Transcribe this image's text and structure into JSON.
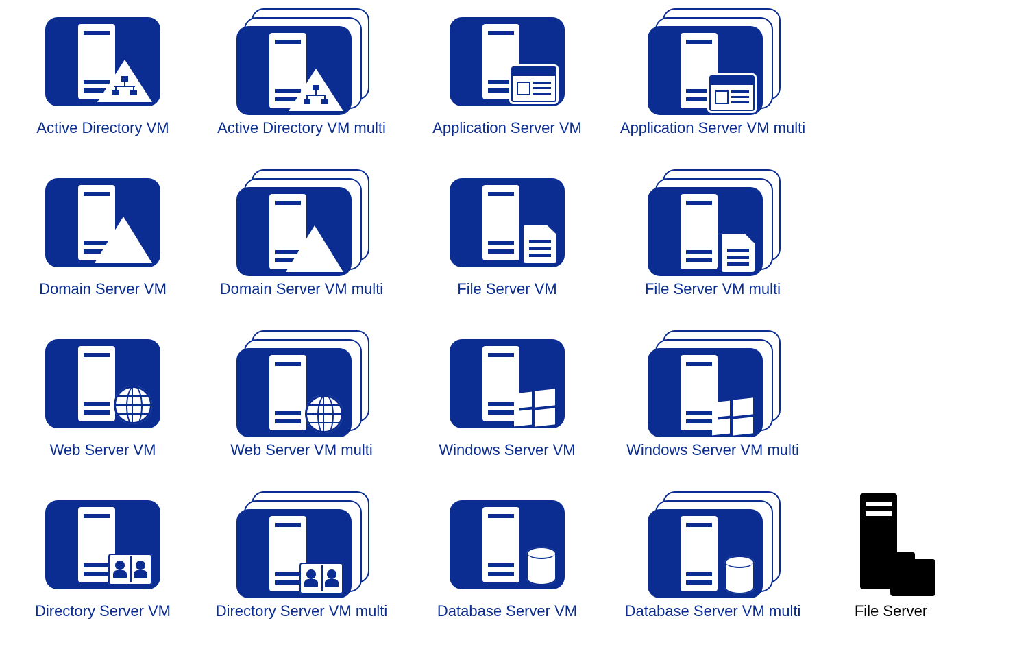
{
  "colors": {
    "brand_blue": "#0b2d91",
    "black": "#000000",
    "white": "#ffffff"
  },
  "icons": [
    {
      "id": "active-directory-vm",
      "label": "Active Directory VM",
      "multi": false,
      "badge": "ad"
    },
    {
      "id": "active-directory-vm-multi",
      "label": "Active Directory VM multi",
      "multi": true,
      "badge": "ad"
    },
    {
      "id": "application-server-vm",
      "label": "Application Server VM",
      "multi": false,
      "badge": "app"
    },
    {
      "id": "application-server-vm-multi",
      "label": "Application Server VM multi",
      "multi": true,
      "badge": "app"
    },
    {
      "id": "domain-server-vm",
      "label": "Domain Server VM",
      "multi": false,
      "badge": "domain"
    },
    {
      "id": "domain-server-vm-multi",
      "label": "Domain Server VM multi",
      "multi": true,
      "badge": "domain"
    },
    {
      "id": "file-server-vm",
      "label": "File Server VM",
      "multi": false,
      "badge": "file"
    },
    {
      "id": "file-server-vm-multi",
      "label": "File Server VM multi",
      "multi": true,
      "badge": "file"
    },
    {
      "id": "web-server-vm",
      "label": "Web Server VM",
      "multi": false,
      "badge": "web"
    },
    {
      "id": "web-server-vm-multi",
      "label": "Web Server VM multi",
      "multi": true,
      "badge": "web"
    },
    {
      "id": "windows-server-vm",
      "label": "Windows Server VM",
      "multi": false,
      "badge": "windows"
    },
    {
      "id": "windows-server-vm-multi",
      "label": "Windows Server VM multi",
      "multi": true,
      "badge": "windows"
    },
    {
      "id": "directory-server-vm",
      "label": "Directory Server VM",
      "multi": false,
      "badge": "directory"
    },
    {
      "id": "directory-server-vm-multi",
      "label": "Directory Server VM multi",
      "multi": true,
      "badge": "directory"
    },
    {
      "id": "database-server-vm",
      "label": "Database Server VM",
      "multi": false,
      "badge": "database"
    },
    {
      "id": "database-server-vm-multi",
      "label": "Database Server VM multi",
      "multi": true,
      "badge": "database"
    }
  ],
  "extra": {
    "id": "file-server",
    "label": "File Server"
  },
  "grid": {
    "rows": 4,
    "cols": 5
  }
}
